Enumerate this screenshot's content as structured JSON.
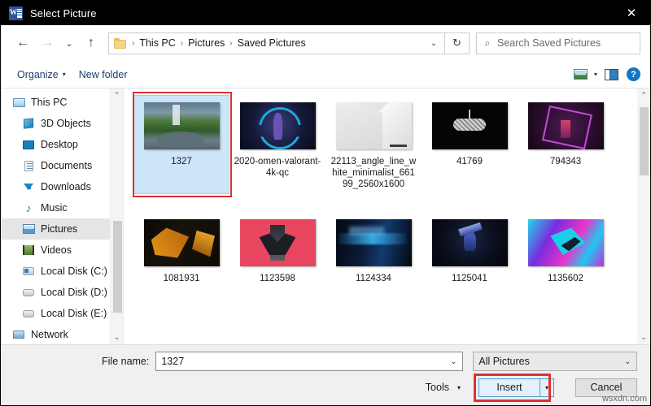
{
  "window": {
    "title": "Select Picture",
    "app_icon": "word-icon",
    "close_label": "✕"
  },
  "nav": {
    "back_icon": "←",
    "forward_icon": "→",
    "recent_icon": "⌄",
    "up_icon": "↑",
    "refresh_icon": "↻",
    "dropdown_icon": "⌄",
    "breadcrumb": [
      "This PC",
      "Pictures",
      "Saved Pictures"
    ],
    "separator": "›"
  },
  "search": {
    "placeholder": "Search Saved Pictures",
    "icon": "⌕"
  },
  "commandbar": {
    "organize_label": "Organize",
    "new_folder_label": "New folder",
    "caret": "▾",
    "view_icon": "picture-view-icon",
    "pane_icon": "preview-pane-icon",
    "help_label": "?"
  },
  "sidebar": {
    "items": [
      {
        "label": "This PC",
        "icon": "pc-icon",
        "selected": false,
        "root": true
      },
      {
        "label": "3D Objects",
        "icon": "3d-icon",
        "selected": false,
        "root": false
      },
      {
        "label": "Desktop",
        "icon": "desktop-icon",
        "selected": false,
        "root": false
      },
      {
        "label": "Documents",
        "icon": "documents-icon",
        "selected": false,
        "root": false
      },
      {
        "label": "Downloads",
        "icon": "downloads-icon",
        "selected": false,
        "root": false
      },
      {
        "label": "Music",
        "icon": "music-icon",
        "selected": false,
        "root": false
      },
      {
        "label": "Pictures",
        "icon": "pictures-icon",
        "selected": true,
        "root": false
      },
      {
        "label": "Videos",
        "icon": "videos-icon",
        "selected": false,
        "root": false
      },
      {
        "label": "Local Disk (C:)",
        "icon": "disk-c-icon",
        "selected": false,
        "root": false
      },
      {
        "label": "Local Disk (D:)",
        "icon": "disk-icon",
        "selected": false,
        "root": false
      },
      {
        "label": "Local Disk (E:)",
        "icon": "disk-icon",
        "selected": false,
        "root": false
      },
      {
        "label": "Network",
        "icon": "network-icon",
        "selected": false,
        "root": true
      }
    ],
    "scroll_up_icon": "⌃",
    "scroll_down_icon": "⌄"
  },
  "files": {
    "items": [
      {
        "name": "1327",
        "thumb": "t-1327",
        "selected": true
      },
      {
        "name": "2020-omen-valorant-4k-qc",
        "thumb": "t-omen",
        "selected": false
      },
      {
        "name": "22113_angle_line_white_minimalist_66199_2560x1600",
        "thumb": "t-angle",
        "selected": false
      },
      {
        "name": "41769",
        "thumb": "t-41769",
        "selected": false
      },
      {
        "name": "794343",
        "thumb": "t-794343",
        "selected": false
      },
      {
        "name": "1081931",
        "thumb": "t-1081931",
        "selected": false
      },
      {
        "name": "1123598",
        "thumb": "t-1123598",
        "selected": false
      },
      {
        "name": "1124334",
        "thumb": "t-1124334",
        "selected": false
      },
      {
        "name": "1125041",
        "thumb": "t-1125041",
        "selected": false
      },
      {
        "name": "1135602",
        "thumb": "t-1135602",
        "selected": false
      }
    ]
  },
  "footer": {
    "filename_label": "File name:",
    "filename_value": "1327",
    "filetype_value": "All Pictures",
    "tools_label": "Tools",
    "insert_label": "Insert",
    "cancel_label": "Cancel",
    "caret": "▾",
    "dropdown_caret": "⌄"
  },
  "watermark": {
    "text": "wsxdn.com"
  },
  "colors": {
    "titlebar_bg": "#000000",
    "selection_bg": "#cce5f8",
    "annotation_red": "#e03030",
    "accent_blue": "#1675c0",
    "insert_bg": "#e4f1fb"
  }
}
